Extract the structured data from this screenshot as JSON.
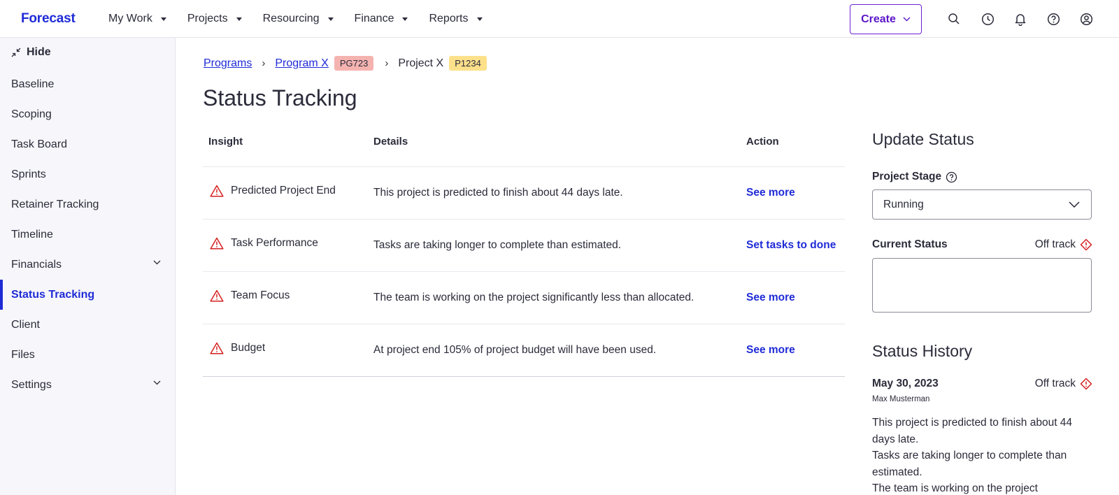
{
  "brand": "Forecast",
  "topnav": [
    {
      "label": "My Work"
    },
    {
      "label": "Projects"
    },
    {
      "label": "Resourcing"
    },
    {
      "label": "Finance"
    },
    {
      "label": "Reports"
    }
  ],
  "create_label": "Create",
  "sidebar": {
    "hide_label": "Hide",
    "items": [
      {
        "label": "Baseline"
      },
      {
        "label": "Scoping"
      },
      {
        "label": "Task Board"
      },
      {
        "label": "Sprints"
      },
      {
        "label": "Retainer Tracking"
      },
      {
        "label": "Timeline"
      },
      {
        "label": "Financials"
      },
      {
        "label": "Status Tracking"
      },
      {
        "label": "Client"
      },
      {
        "label": "Files"
      },
      {
        "label": "Settings"
      }
    ]
  },
  "breadcrumb": {
    "programs": "Programs",
    "program": "Program X",
    "program_badge": "PG723",
    "project": "Project X",
    "project_badge": "P1234"
  },
  "colors": {
    "accent": "#1f2bd6",
    "program_badge_bg": "#f5b3b0",
    "project_badge_bg": "#fde08a",
    "warning": "#d42020"
  },
  "page_title": "Status Tracking",
  "table": {
    "headers": {
      "insight": "Insight",
      "details": "Details",
      "action": "Action"
    },
    "rows": [
      {
        "insight": "Predicted Project End",
        "details": "This project is predicted to finish about 44 days late.",
        "action": "See more"
      },
      {
        "insight": "Task Performance",
        "details": "Tasks are taking longer to complete than estimated.",
        "action": "Set tasks to done"
      },
      {
        "insight": "Team Focus",
        "details": "The team is working on the project significantly less than allocated.",
        "action": "See more"
      },
      {
        "insight": "Budget",
        "details": "At project end 105% of project budget will have been used.",
        "action": "See more"
      }
    ]
  },
  "update_status": {
    "title": "Update Status",
    "stage_label": "Project Stage",
    "stage_value": "Running",
    "current_status_label": "Current Status",
    "current_status_value": "Off track",
    "textarea_value": ""
  },
  "status_history": {
    "title": "Status History",
    "entry": {
      "date": "May 30, 2023",
      "status": "Off track",
      "author": "Max Musterman",
      "lines": [
        "This project is predicted to finish about 44 days late.",
        "Tasks are taking longer to complete than estimated.",
        "The team is working on the project"
      ]
    }
  }
}
